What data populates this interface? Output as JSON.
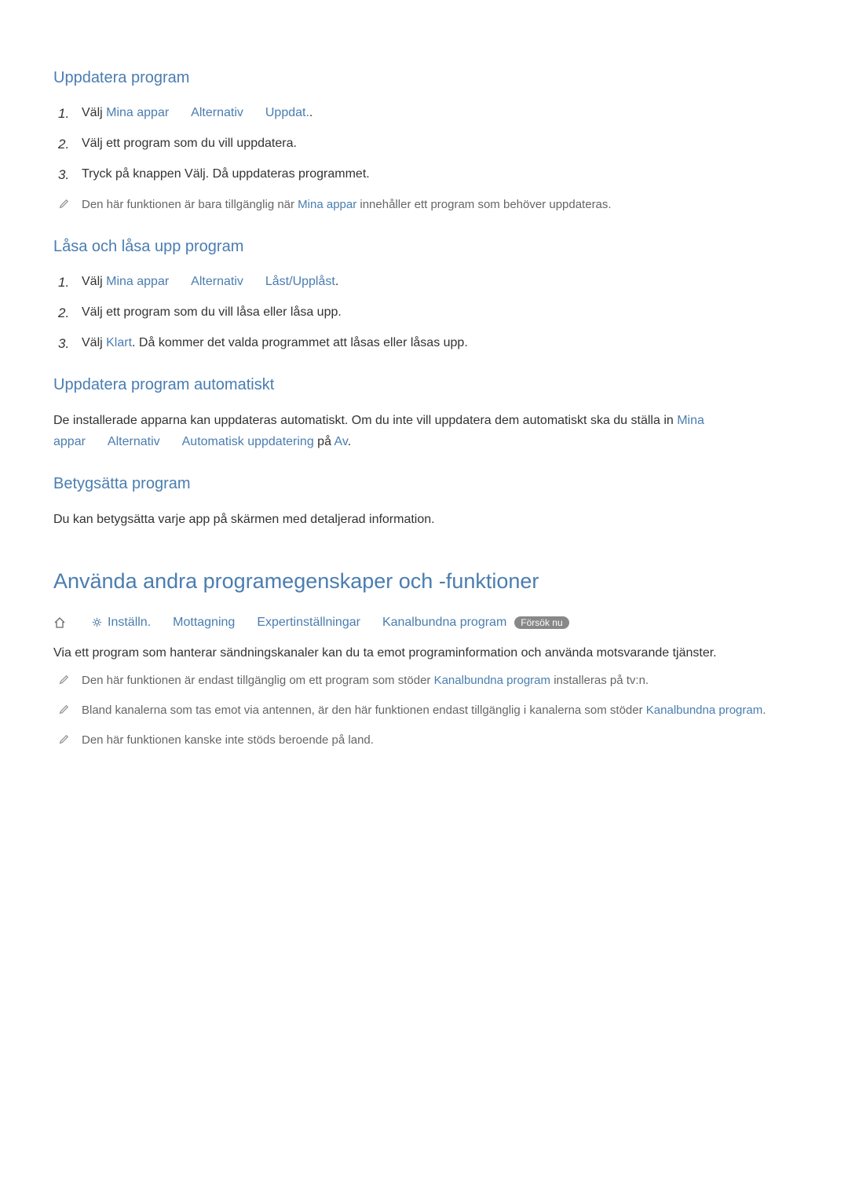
{
  "headings": {
    "update_apps": "Uppdatera program",
    "lock_unlock": "Låsa och låsa upp program",
    "auto_update": "Uppdatera program automatiskt",
    "rate_apps": "Betygsätta program",
    "main": "Använda andra programegenskaper och -funktioner"
  },
  "section1": {
    "step1_prefix": "Välj ",
    "step1_link1": "Mina appar",
    "step1_link2": "Alternativ",
    "step1_link3": "Uppdat.",
    "step1_suffix": ".",
    "step2": "Välj ett program som du vill uppdatera.",
    "step3": "Tryck på knappen Välj. Då uppdateras programmet.",
    "note_prefix": "Den här funktionen är bara tillgänglig när ",
    "note_link": "Mina appar",
    "note_suffix": " innehåller ett program som behöver uppdateras."
  },
  "section2": {
    "step1_prefix": "Välj ",
    "step1_link1": "Mina appar",
    "step1_link2": "Alternativ",
    "step1_link3": "Låst/Upplåst",
    "step1_suffix": ".",
    "step2": "Välj ett program som du vill låsa eller låsa upp.",
    "step3_prefix": "Välj ",
    "step3_link": "Klart",
    "step3_suffix": ". Då kommer det valda programmet att låsas eller låsas upp."
  },
  "section3": {
    "para_prefix": "De installerade apparna kan uppdateras automatiskt. Om du inte vill uppdatera dem automatiskt ska du ställa in ",
    "link1": "Mina appar",
    "link2": "Alternativ",
    "link3": "Automatisk uppdatering",
    "mid": " på ",
    "link4": "Av",
    "suffix": "."
  },
  "section4": {
    "para": "Du kan betygsätta varje app på skärmen med detaljerad information."
  },
  "breadcrumb": {
    "link1": "Inställn.",
    "link2": "Mottagning",
    "link3": "Expertinställningar",
    "link4": "Kanalbundna program",
    "badge": "Försök nu"
  },
  "section5": {
    "para": "Via ett program som hanterar sändningskanaler kan du ta emot programinformation och använda motsvarande tjänster.",
    "note1_prefix": "Den här funktionen är endast tillgänglig om ett program som stöder ",
    "note1_link": "Kanalbundna program",
    "note1_suffix": " installeras på tv:n.",
    "note2_prefix": "Bland kanalerna som tas emot via antennen, är den här funktionen endast tillgänglig i kanalerna som stöder ",
    "note2_link": "Kanalbundna program",
    "note2_suffix": ".",
    "note3": "Den här funktionen kanske inte stöds beroende på land."
  },
  "numbers": {
    "n1": "1.",
    "n2": "2.",
    "n3": "3."
  }
}
